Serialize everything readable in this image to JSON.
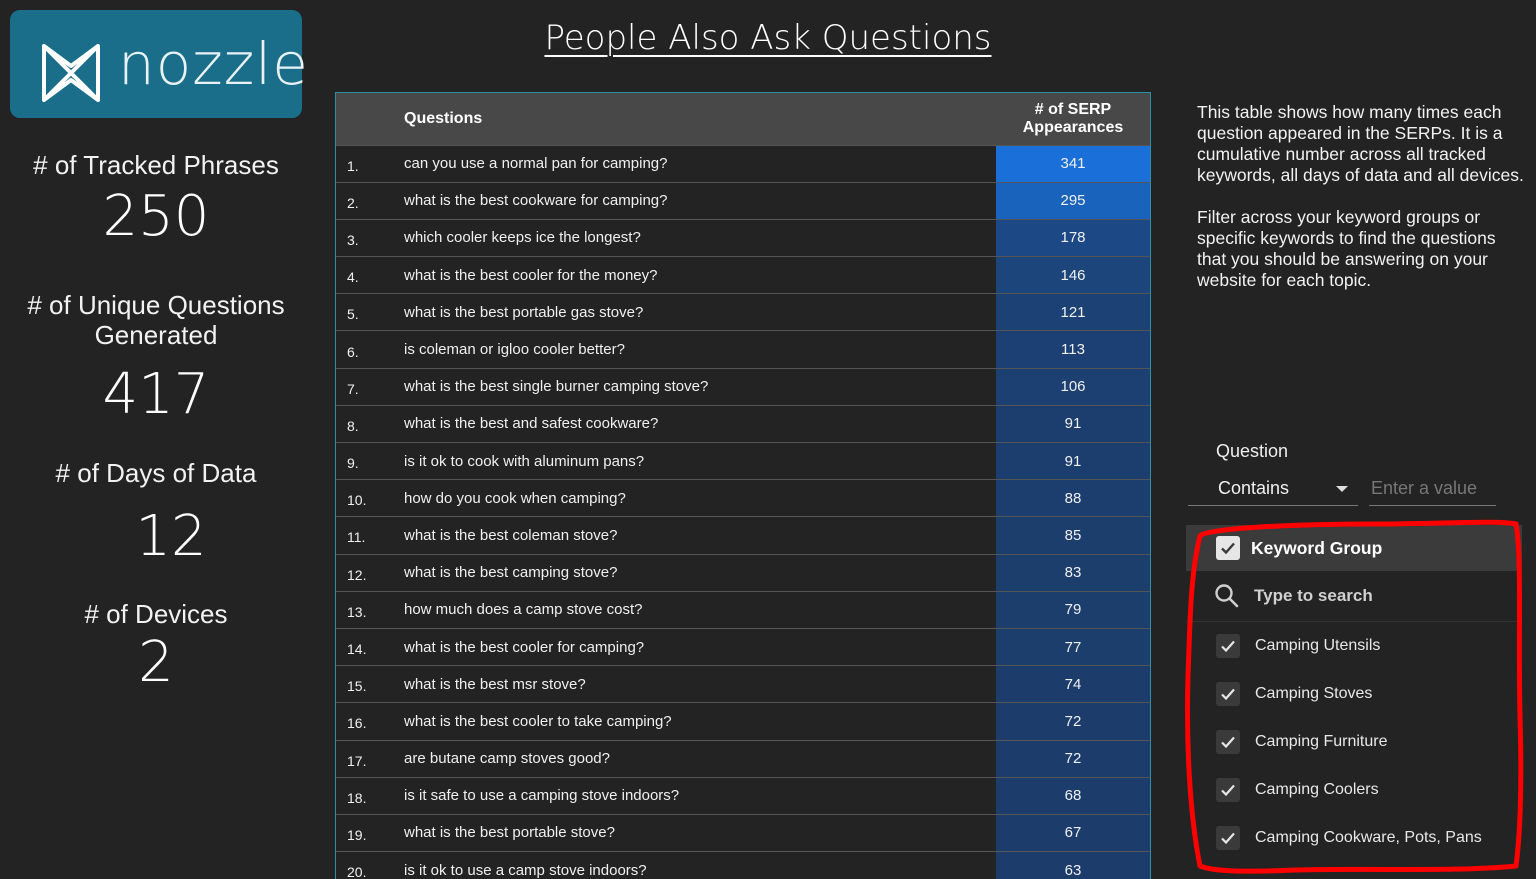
{
  "logo": {
    "text": "nozzle"
  },
  "page_title": "People Also Ask Questions",
  "stats": [
    {
      "label": "# of Tracked Phrases",
      "value": "250"
    },
    {
      "label": "# of Unique Questions Generated",
      "value": "417"
    },
    {
      "label": "# of Days of Data",
      "value": "12"
    },
    {
      "label": "# of Devices",
      "value": "2"
    }
  ],
  "table": {
    "header_questions": "Questions",
    "header_count_line1": "# of SERP",
    "header_count_line2": "Appearances",
    "rows": [
      {
        "idx": "1.",
        "question": "can you use a normal pan for camping?",
        "count": "341"
      },
      {
        "idx": "2.",
        "question": "what is the best cookware for camping?",
        "count": "295"
      },
      {
        "idx": "3.",
        "question": "which cooler keeps ice the longest?",
        "count": "178"
      },
      {
        "idx": "4.",
        "question": "what is the best cooler for the money?",
        "count": "146"
      },
      {
        "idx": "5.",
        "question": "what is the best portable gas stove?",
        "count": "121"
      },
      {
        "idx": "6.",
        "question": "is coleman or igloo cooler better?",
        "count": "113"
      },
      {
        "idx": "7.",
        "question": "what is the best single burner camping stove?",
        "count": "106"
      },
      {
        "idx": "8.",
        "question": "what is the best and safest cookware?",
        "count": "91"
      },
      {
        "idx": "9.",
        "question": "is it ok to cook with aluminum pans?",
        "count": "91"
      },
      {
        "idx": "10.",
        "question": "how do you cook when camping?",
        "count": "88"
      },
      {
        "idx": "11.",
        "question": "what is the best coleman stove?",
        "count": "85"
      },
      {
        "idx": "12.",
        "question": "what is the best camping stove?",
        "count": "83"
      },
      {
        "idx": "13.",
        "question": "how much does a camp stove cost?",
        "count": "79"
      },
      {
        "idx": "14.",
        "question": "what is the best cooler for camping?",
        "count": "77"
      },
      {
        "idx": "15.",
        "question": "what is the best msr stove?",
        "count": "74"
      },
      {
        "idx": "16.",
        "question": "what is the best cooler to take camping?",
        "count": "72"
      },
      {
        "idx": "17.",
        "question": "are butane camp stoves good?",
        "count": "72"
      },
      {
        "idx": "18.",
        "question": "is it safe to use a camping stove indoors?",
        "count": "68"
      },
      {
        "idx": "19.",
        "question": "what is the best portable stove?",
        "count": "67"
      },
      {
        "idx": "20.",
        "question": "is it ok to use a camp stove indoors?",
        "count": "63"
      }
    ]
  },
  "description": {
    "para1": "This table shows how many times each question appeared in the SERPs. It is a cumulative number across all tracked keywords, all days of data and all devices.",
    "para2": "Filter across your keyword groups or specific keywords to find the questions that you should be answering on your website for each topic."
  },
  "question_filter": {
    "label": "Question",
    "operator": "Contains",
    "placeholder": "Enter a value"
  },
  "keyword_group": {
    "title": "Keyword Group",
    "search_placeholder": "Type to search",
    "items": [
      "Camping Utensils",
      "Camping Stoves",
      "Camping Furniture",
      "Camping Coolers",
      "Camping Cookware, Pots, Pans"
    ]
  },
  "colors": {
    "background": "#232323",
    "logo_bg": "#1b6e8a",
    "table_border": "#2e8fa8",
    "count_high": "#1a6fd8",
    "count_low": "#1c3d6b",
    "annotation": "#ff0000"
  }
}
